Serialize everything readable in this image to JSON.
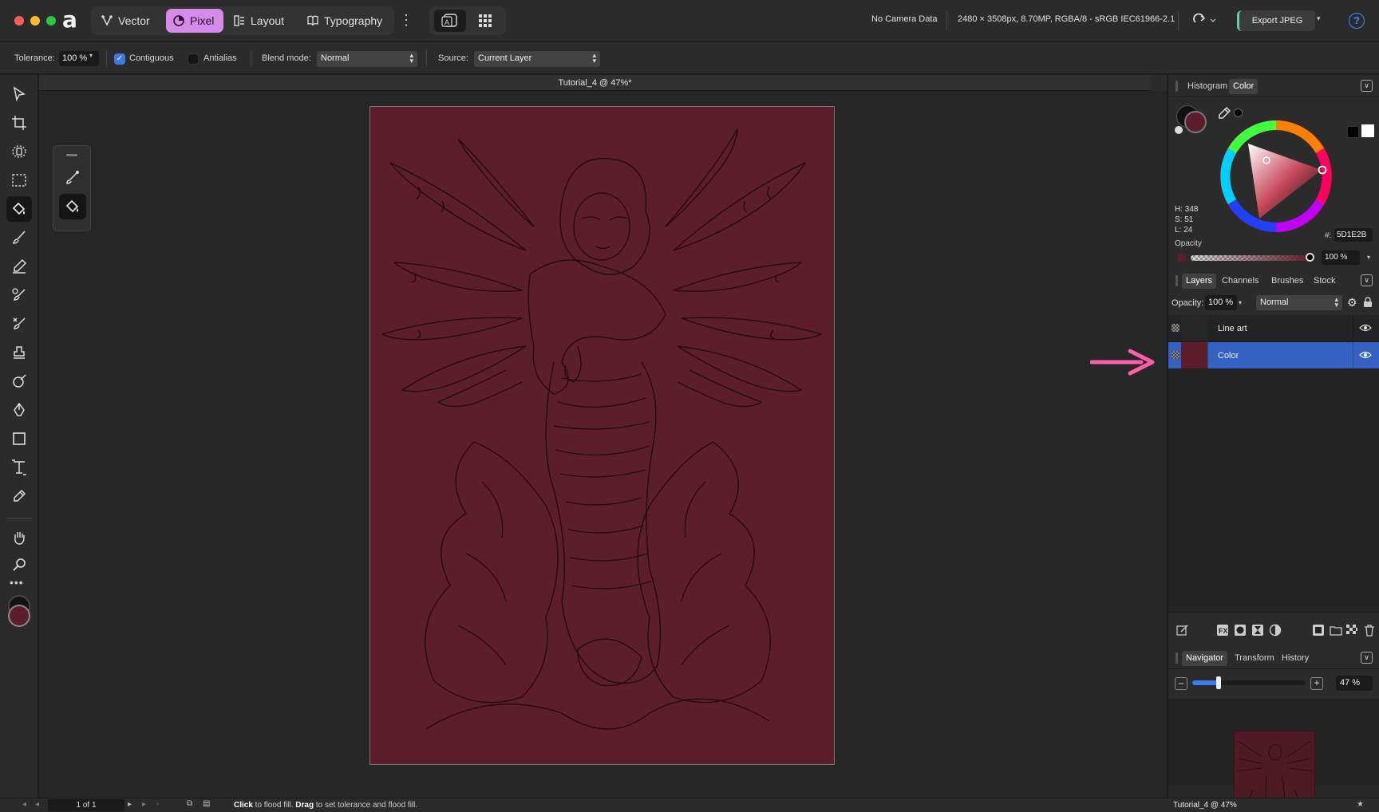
{
  "app": {
    "logo_glyph": "a",
    "personas": [
      {
        "label": "Vector",
        "icon": "vector-persona-icon"
      },
      {
        "label": "Pixel",
        "icon": "pixel-persona-icon",
        "active": true
      },
      {
        "label": "Layout",
        "icon": "layout-persona-icon"
      },
      {
        "label": "Typography",
        "icon": "typography-persona-icon"
      }
    ],
    "more_glyph": "⋮",
    "camera_data": "No Camera Data",
    "doc_info": "2480 × 3508px, 8.70MP, RGBA/8 - sRGB IEC61966-2.1",
    "export_label": "Export JPEG",
    "help_glyph": "?",
    "accent_color": "#d68be8"
  },
  "context": {
    "tolerance_label": "Tolerance:",
    "tolerance_value": "100 %",
    "contiguous_label": "Contiguous",
    "contiguous_checked": true,
    "antialias_label": "Antialias",
    "antialias_checked": false,
    "blend_label": "Blend mode:",
    "blend_value": "Normal",
    "source_label": "Source:",
    "source_value": "Current Layer"
  },
  "canvas": {
    "doc_tab": "Tutorial_4 @ 47%*",
    "fill_color": "#5d1e2b"
  },
  "color_panel": {
    "tabs": [
      "Histogram",
      "Color"
    ],
    "active_tab": "Color",
    "h": "H: 348",
    "s": "S: 51",
    "l": "L: 24",
    "hex_label": "#:",
    "hex": "5D1E2B",
    "opacity_label": "Opacity",
    "opacity_value": "100 %"
  },
  "layers_panel": {
    "tabs": [
      "Layers",
      "Channels",
      "Brushes",
      "Stock"
    ],
    "active_tab": "Layers",
    "opacity_label": "Opacity:",
    "opacity_value": "100 %",
    "blend_value": "Normal",
    "layers": [
      {
        "name": "Line art",
        "selected": false
      },
      {
        "name": "Color",
        "selected": true
      }
    ]
  },
  "navigator": {
    "tabs": [
      "Navigator",
      "Transform",
      "History"
    ],
    "active_tab": "Navigator",
    "zoom": "47 %",
    "zoom_fraction": 0.47
  },
  "status": {
    "pager": "1 of 1",
    "hint_click": "Click",
    "hint_mid": " to flood fill. ",
    "hint_drag": "Drag",
    "hint_end": " to set tolerance and flood fill.",
    "doc_name": "Tutorial_4 @ 47%"
  },
  "annotation": {
    "arrow_color": "#ff5fa8"
  }
}
